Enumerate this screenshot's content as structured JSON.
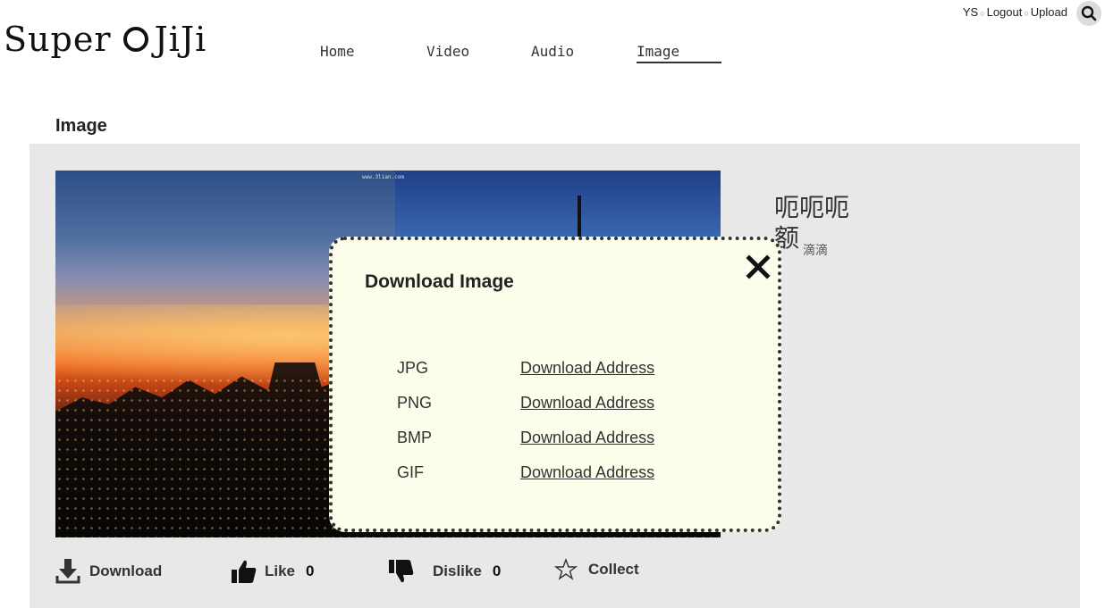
{
  "header": {
    "logo_left": "Super",
    "logo_right": "JiJi",
    "nav": [
      "Home",
      "Video",
      "Audio",
      "Image"
    ],
    "active_nav": "Image",
    "user": "YS",
    "logout": "Logout",
    "upload": "Upload"
  },
  "section_title": "Image",
  "image": {
    "watermark": "www.3lian.com",
    "title": "呃呃呃额",
    "description": "滴滴"
  },
  "modal": {
    "title": "Download Image",
    "formats": [
      {
        "format": "JPG",
        "link": "Download Address"
      },
      {
        "format": "PNG",
        "link": "Download Address"
      },
      {
        "format": "BMP",
        "link": "Download Address"
      },
      {
        "format": "GIF",
        "link": "Download Address"
      }
    ]
  },
  "actions": {
    "download": "Download",
    "like": "Like",
    "like_count": "0",
    "dislike": "Dislike",
    "dislike_count": "0",
    "collect": "Collect"
  }
}
